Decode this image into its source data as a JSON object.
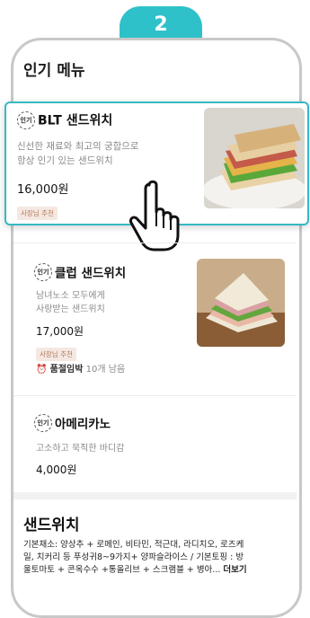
{
  "step_number": "2",
  "section_title": "인기 메뉴",
  "popular_badge": "인기",
  "items": [
    {
      "name": "BLT 샌드위치",
      "desc_lines": [
        "신선한 재료와 최고의 궁합으로",
        "항상 인기 있는 샌드위치"
      ],
      "price": "16,000원",
      "tag": "사장님 추천"
    },
    {
      "name": "클럽 샌드위치",
      "desc_lines": [
        "남녀노소 모두에게",
        "사랑받는 샌드위치"
      ],
      "price": "17,000원",
      "tag": "사장님 추천",
      "stock_label": "품절임박",
      "stock_remaining": "10개 남음"
    },
    {
      "name": "아메리카노",
      "desc_lines": [
        "고소하고 묵직한 바디감"
      ],
      "price": "4,000원"
    }
  ],
  "category": {
    "title": "샌드위치",
    "desc_lines": [
      "기본채소: 양상추 + 로메인, 비타민, 적근대, 라디치오, 로즈케",
      "일, 치커리 등 푸성귀8~9가지+ 양파슬라이스 / 기본토핑 : 방",
      "울토마토 + 콘옥수수 +통올리브 + 스크램블 + 병아..."
    ],
    "more_label": "더보기"
  },
  "colors": {
    "accent": "#2ec1c9",
    "tag_bg": "#f5e8e2",
    "tag_text": "#b07a5a"
  },
  "icons": [
    "hand-pointer-icon",
    "alarm-clock-icon",
    "popular-badge-icon"
  ]
}
